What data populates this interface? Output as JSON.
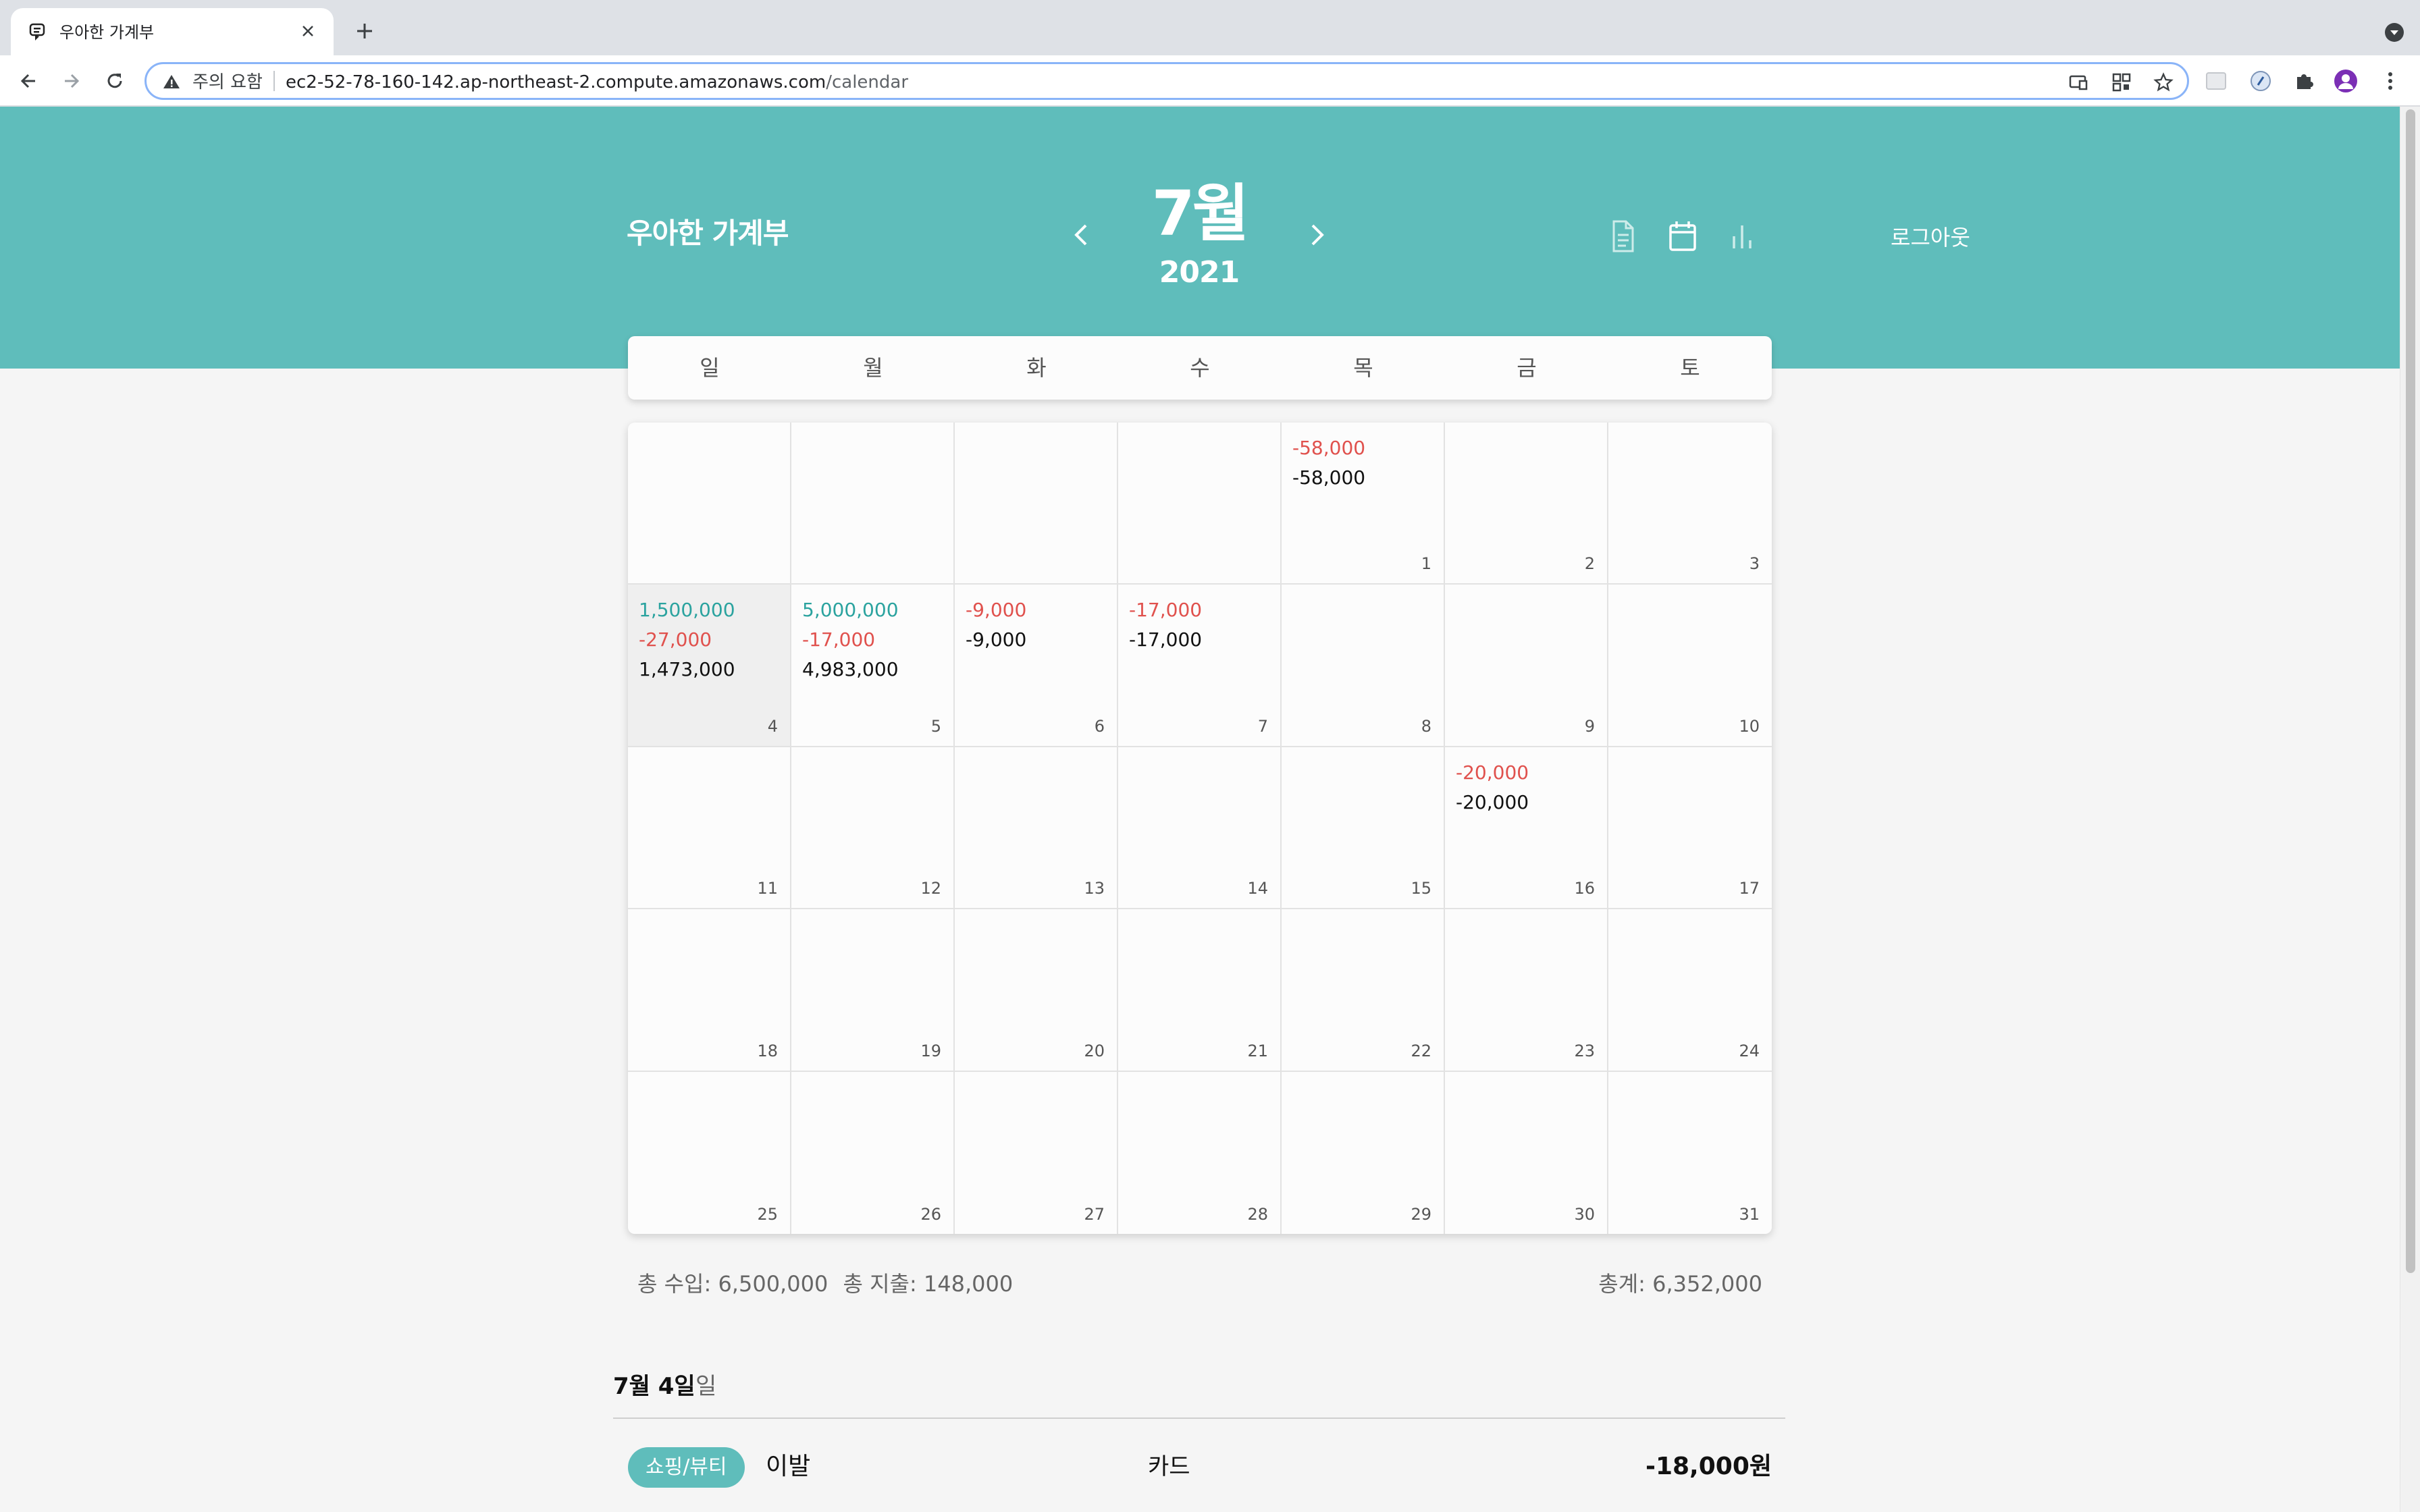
{
  "browser": {
    "tab_title": "우아한 가계부",
    "security_label": "주의 요함",
    "url_host": "ec2-52-78-160-142.ap-northeast-2.compute.amazonaws.com",
    "url_path": "/calendar"
  },
  "header": {
    "app_title": "우아한 가계부",
    "month": "7월",
    "year": "2021",
    "logout_label": "로그아웃"
  },
  "weekdays": [
    "일",
    "월",
    "화",
    "수",
    "목",
    "금",
    "토"
  ],
  "calendar": {
    "cells": [
      {
        "date": "",
        "income": "",
        "expense": "",
        "total": ""
      },
      {
        "date": "",
        "income": "",
        "expense": "",
        "total": ""
      },
      {
        "date": "",
        "income": "",
        "expense": "",
        "total": ""
      },
      {
        "date": "",
        "income": "",
        "expense": "",
        "total": ""
      },
      {
        "date": "1",
        "income": "",
        "expense": "-58,000",
        "total": "-58,000"
      },
      {
        "date": "2",
        "income": "",
        "expense": "",
        "total": ""
      },
      {
        "date": "3",
        "income": "",
        "expense": "",
        "total": ""
      },
      {
        "date": "4",
        "income": "1,500,000",
        "expense": "-27,000",
        "total": "1,473,000"
      },
      {
        "date": "5",
        "income": "5,000,000",
        "expense": "-17,000",
        "total": "4,983,000"
      },
      {
        "date": "6",
        "income": "",
        "expense": "-9,000",
        "total": "-9,000"
      },
      {
        "date": "7",
        "income": "",
        "expense": "-17,000",
        "total": "-17,000"
      },
      {
        "date": "8",
        "income": "",
        "expense": "",
        "total": ""
      },
      {
        "date": "9",
        "income": "",
        "expense": "",
        "total": ""
      },
      {
        "date": "10",
        "income": "",
        "expense": "",
        "total": ""
      },
      {
        "date": "11",
        "income": "",
        "expense": "",
        "total": ""
      },
      {
        "date": "12",
        "income": "",
        "expense": "",
        "total": ""
      },
      {
        "date": "13",
        "income": "",
        "expense": "",
        "total": ""
      },
      {
        "date": "14",
        "income": "",
        "expense": "",
        "total": ""
      },
      {
        "date": "15",
        "income": "",
        "expense": "",
        "total": ""
      },
      {
        "date": "16",
        "income": "",
        "expense": "-20,000",
        "total": "-20,000"
      },
      {
        "date": "17",
        "income": "",
        "expense": "",
        "total": ""
      },
      {
        "date": "18",
        "income": "",
        "expense": "",
        "total": ""
      },
      {
        "date": "19",
        "income": "",
        "expense": "",
        "total": ""
      },
      {
        "date": "20",
        "income": "",
        "expense": "",
        "total": ""
      },
      {
        "date": "21",
        "income": "",
        "expense": "",
        "total": ""
      },
      {
        "date": "22",
        "income": "",
        "expense": "",
        "total": ""
      },
      {
        "date": "23",
        "income": "",
        "expense": "",
        "total": ""
      },
      {
        "date": "24",
        "income": "",
        "expense": "",
        "total": ""
      },
      {
        "date": "25",
        "income": "",
        "expense": "",
        "total": ""
      },
      {
        "date": "26",
        "income": "",
        "expense": "",
        "total": ""
      },
      {
        "date": "27",
        "income": "",
        "expense": "",
        "total": ""
      },
      {
        "date": "28",
        "income": "",
        "expense": "",
        "total": ""
      },
      {
        "date": "29",
        "income": "",
        "expense": "",
        "total": ""
      },
      {
        "date": "30",
        "income": "",
        "expense": "",
        "total": ""
      },
      {
        "date": "31",
        "income": "",
        "expense": "",
        "total": ""
      }
    ]
  },
  "summary": {
    "total_income": "총 수입: 6,500,000",
    "total_expense": "총 지출: 148,000",
    "grand_total": "총계: 6,352,000"
  },
  "day_detail": {
    "date_label": "7월 4일",
    "weekday_label": "일",
    "records": [
      {
        "category": "쇼핑/뷰티",
        "title": "이발",
        "method": "카드",
        "amount": "-18,000원"
      }
    ]
  },
  "colors": {
    "brand": "#5fbdbb",
    "income": "#2ba39f",
    "expense": "#e0514d"
  },
  "icons": {
    "view_list": "document-icon",
    "view_calendar": "calendar-icon",
    "view_chart": "bar-chart-icon"
  }
}
